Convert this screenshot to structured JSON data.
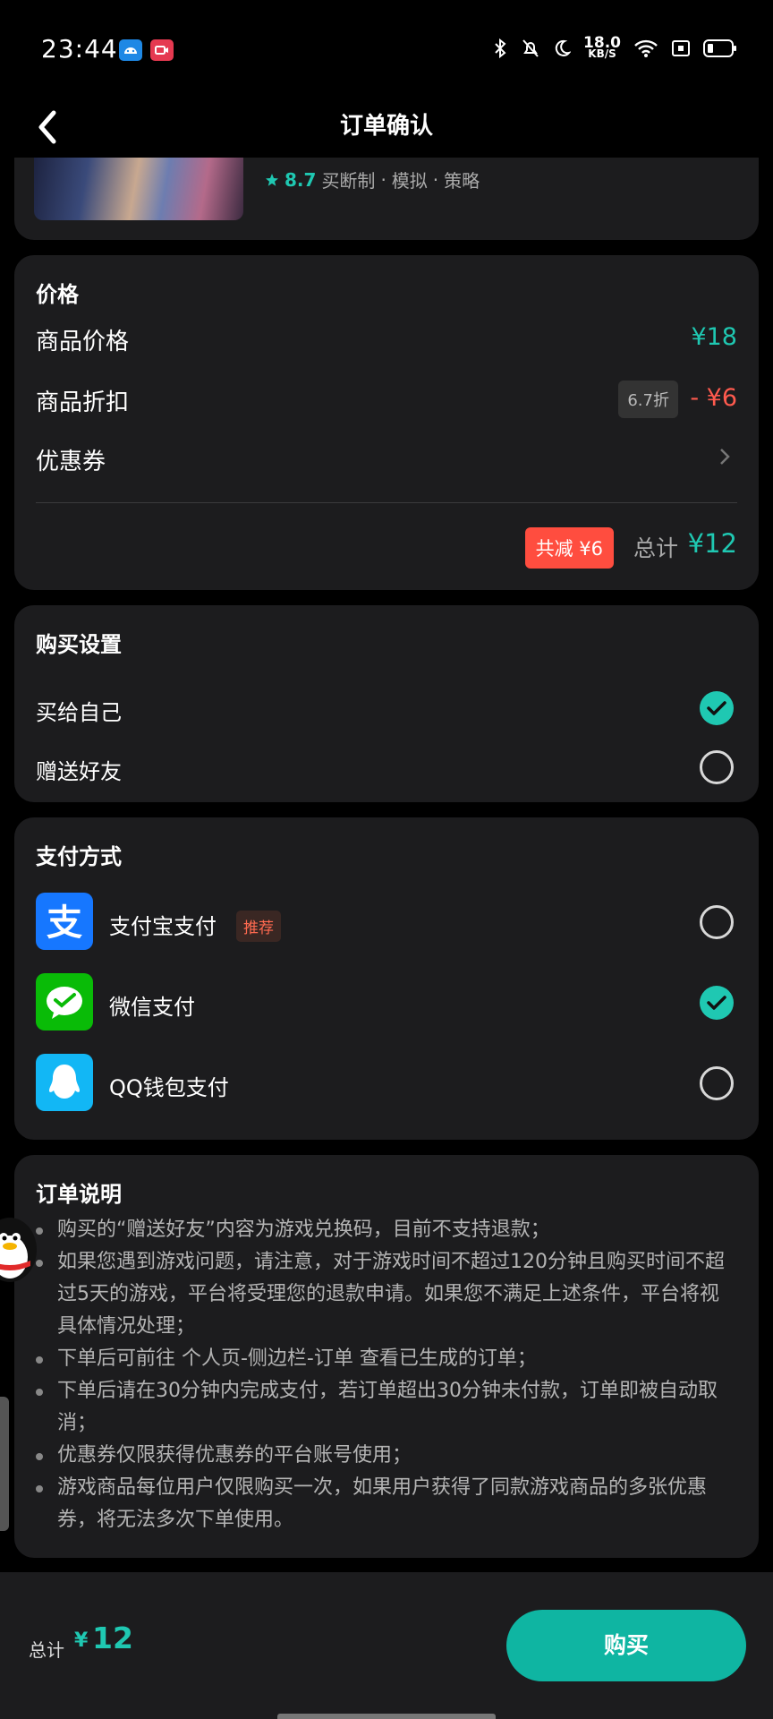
{
  "status_bar": {
    "time": "23:44",
    "net_speed": "18.0",
    "net_unit": "KB/S",
    "icons": [
      "android-icon",
      "video-record-icon",
      "bluetooth-icon",
      "bell-off-icon",
      "moon-icon",
      "wifi-icon",
      "sim-icon",
      "battery-icon"
    ]
  },
  "nav": {
    "title": "订单确认",
    "back_icon": "back-arrow-icon"
  },
  "game": {
    "score": "8.7",
    "tags": [
      "买断制",
      "模拟",
      "策略"
    ],
    "sep": "·"
  },
  "price": {
    "title": "价格",
    "item_price_label": "商品价格",
    "item_price_value": "¥18",
    "discount_label": "商品折扣",
    "discount_tag": "6.7折",
    "discount_value": "- ¥6",
    "coupon_label": "优惠券",
    "saved_badge": "共减 ¥6",
    "total_label": "总计",
    "total_value": "¥12"
  },
  "purchase": {
    "title": "购买设置",
    "options": [
      {
        "label": "买给自己",
        "selected": true
      },
      {
        "label": "赠送好友",
        "selected": false
      }
    ]
  },
  "payment": {
    "title": "支付方式",
    "methods": [
      {
        "label": "支付宝支付",
        "badge": "推荐",
        "selected": false,
        "icon": "alipay-icon",
        "color": "#1677ff"
      },
      {
        "label": "微信支付",
        "selected": true,
        "icon": "wechat-pay-icon",
        "color": "#09bb07"
      },
      {
        "label": "QQ钱包支付",
        "selected": false,
        "icon": "qq-wallet-icon",
        "color": "#12b7f5"
      }
    ]
  },
  "notes": {
    "title": "订单说明",
    "items": [
      "购买的“赠送好友”内容为游戏兑换码，目前不支持退款；",
      "如果您遇到游戏问题，请注意，对于游戏时间不超过120分钟且购买时间不超过5天的游戏，平台将受理您的退款申请。如果您不满足上述条件，平台将视具体情况处理；",
      "下单后可前往 个人页-侧边栏-订单 查看已生成的订单；",
      "下单后请在30分钟内完成支付，若订单超出30分钟未付款，订单即被自动取消；",
      "优惠券仅限获得优惠券的平台账号使用；",
      "游戏商品每位用户仅限购买一次，如果用户获得了同款游戏商品的多张优惠券，将无法多次下单使用。"
    ]
  },
  "bottom": {
    "total_label": "总计",
    "currency": "¥",
    "total_value": "12",
    "buy_label": "购买"
  },
  "colors": {
    "accent": "#1fc8b2",
    "danger": "#ff4d3f",
    "card_bg": "#1c1c1e"
  }
}
